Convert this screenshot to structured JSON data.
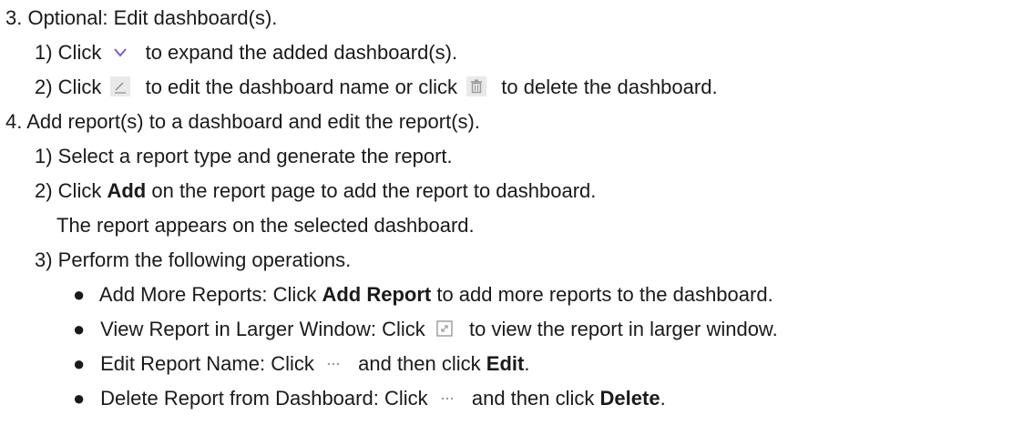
{
  "step3": {
    "title": "3. Optional: Edit dashboard(s).",
    "sub1_pre": "1) Click",
    "sub1_post": "to expand the added dashboard(s).",
    "sub2_pre": "2) Click",
    "sub2_mid": "to edit the dashboard name or click",
    "sub2_post": "to delete the dashboard."
  },
  "step4": {
    "title": "4. Add report(s) to a dashboard and edit the report(s).",
    "sub1": "1) Select a report type and generate the report.",
    "sub2_pre": "2) Click",
    "sub2_bold": "Add",
    "sub2_post": "on the report page to add the report to dashboard.",
    "sub2_note": "The report appears on the selected dashboard.",
    "sub3": "3) Perform the following operations.",
    "bullets": [
      {
        "pre": "Add More Reports: Click",
        "bold": "Add Report",
        "post": "to add more reports to the dashboard."
      },
      {
        "pre": "View Report in Larger Window: Click",
        "post": "to view the report in larger window."
      },
      {
        "pre": "Edit Report Name: Click",
        "mid": "and then click",
        "bold": "Edit",
        "post": "."
      },
      {
        "pre": "Delete Report from Dashboard: Click",
        "mid": "and then click",
        "bold": "Delete",
        "post": "."
      }
    ]
  },
  "bullet_glyph": "●",
  "icons": [
    "chevron-down-icon",
    "pencil-icon",
    "trash-icon",
    "expand-icon",
    "more-dots-icon"
  ],
  "colors": {
    "text": "#1a1a1a",
    "chevron": "#7b5fd0",
    "icon_gray": "#9a9a9a",
    "icon_bg": "#e9e9e9"
  }
}
